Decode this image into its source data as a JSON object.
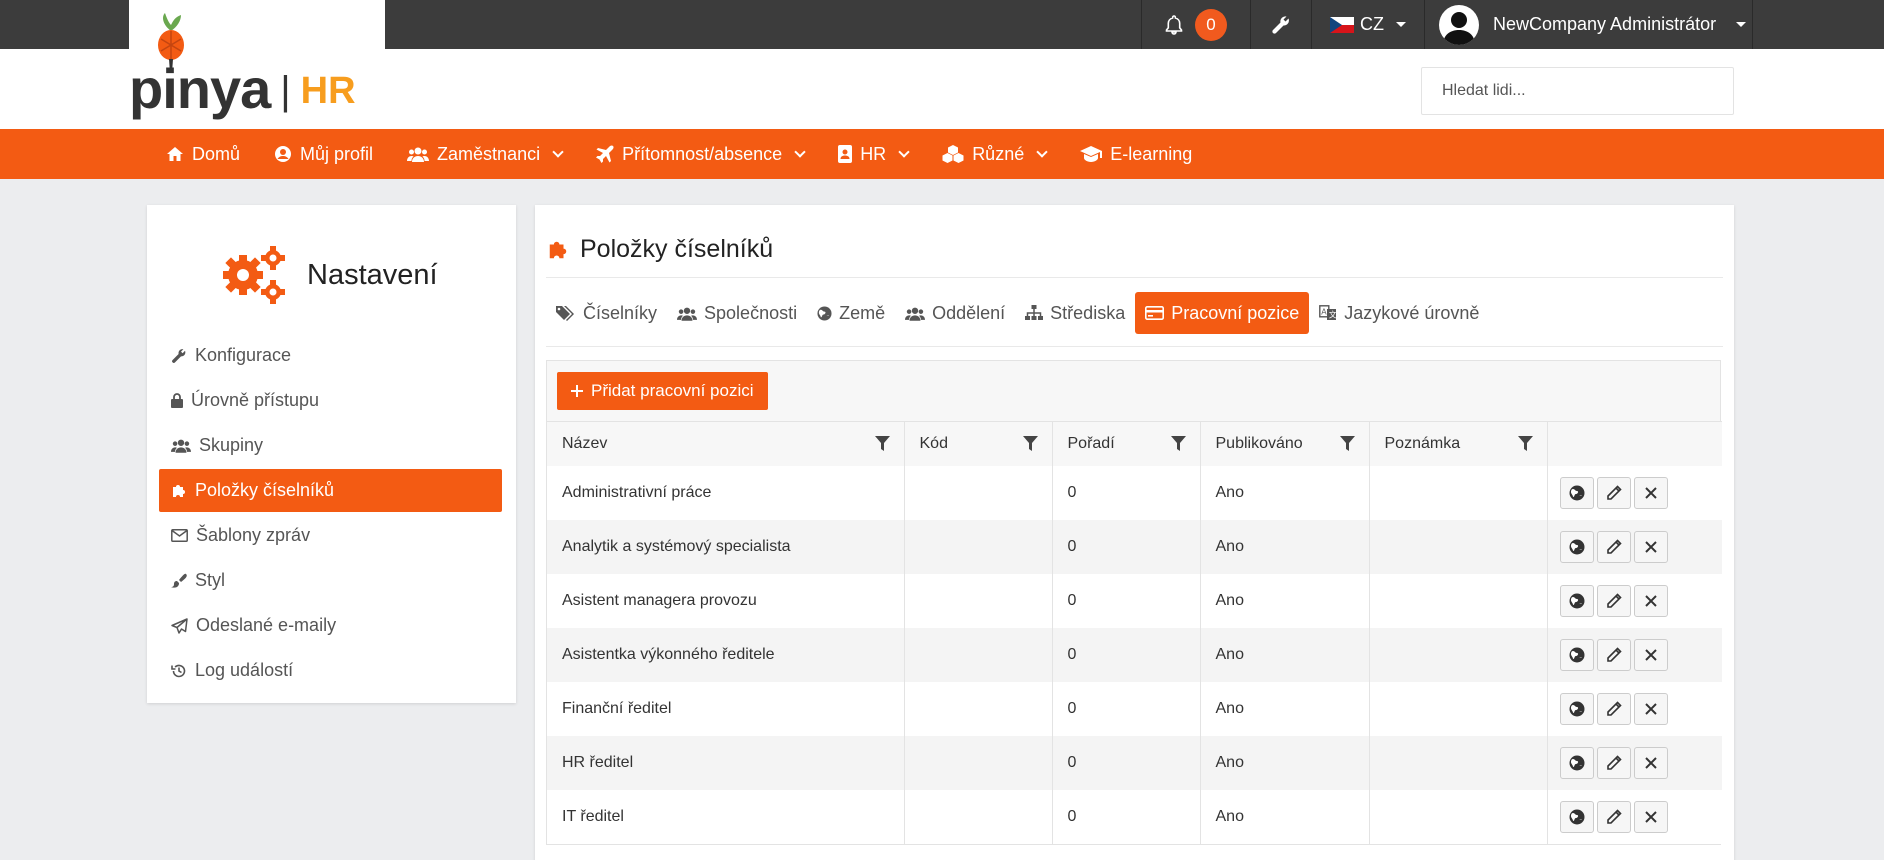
{
  "topbar": {
    "notifications_count": "0",
    "language": "CZ",
    "user_name": "NewCompany Administrátor"
  },
  "header": {
    "logo_text": "pinya",
    "logo_separator": "|",
    "logo_suffix": "HR",
    "search_placeholder": "Hledat lidi..."
  },
  "nav": {
    "items": [
      {
        "label": "Domů"
      },
      {
        "label": "Můj profil"
      },
      {
        "label": "Zaměstnanci"
      },
      {
        "label": "Přítomnost/absence"
      },
      {
        "label": "HR"
      },
      {
        "label": "Různé"
      },
      {
        "label": "E-learning"
      }
    ]
  },
  "sidebar": {
    "title": "Nastavení",
    "items": [
      {
        "label": "Konfigurace"
      },
      {
        "label": "Úrovně přístupu"
      },
      {
        "label": "Skupiny"
      },
      {
        "label": "Položky číselníků"
      },
      {
        "label": "Šablony zpráv"
      },
      {
        "label": "Styl"
      },
      {
        "label": "Odeslané e-maily"
      },
      {
        "label": "Log událostí"
      }
    ]
  },
  "main": {
    "title": "Položky číselníků",
    "tabs": [
      {
        "label": "Číselníky"
      },
      {
        "label": "Společnosti"
      },
      {
        "label": "Země"
      },
      {
        "label": "Oddělení"
      },
      {
        "label": "Střediska"
      },
      {
        "label": "Pracovní pozice"
      },
      {
        "label": "Jazykové úrovně"
      }
    ],
    "add_button": "Přidat pracovní pozici",
    "columns": [
      "Název",
      "Kód",
      "Pořadí",
      "Publikováno",
      "Poznámka"
    ],
    "rows": [
      {
        "name": "Administrativní práce",
        "code": "",
        "order": "0",
        "published": "Ano",
        "note": ""
      },
      {
        "name": "Analytik a systémový specialista",
        "code": "",
        "order": "0",
        "published": "Ano",
        "note": ""
      },
      {
        "name": "Asistent managera provozu",
        "code": "",
        "order": "0",
        "published": "Ano",
        "note": ""
      },
      {
        "name": "Asistentka výkonného ředitele",
        "code": "",
        "order": "0",
        "published": "Ano",
        "note": ""
      },
      {
        "name": "Finanční ředitel",
        "code": "",
        "order": "0",
        "published": "Ano",
        "note": ""
      },
      {
        "name": "HR ředitel",
        "code": "",
        "order": "0",
        "published": "Ano",
        "note": ""
      },
      {
        "name": "IT ředitel",
        "code": "",
        "order": "0",
        "published": "Ano",
        "note": ""
      }
    ]
  },
  "colors": {
    "accent": "#f35b13",
    "topbar": "#3c3c3c",
    "logo_hr": "#f79d1e"
  }
}
